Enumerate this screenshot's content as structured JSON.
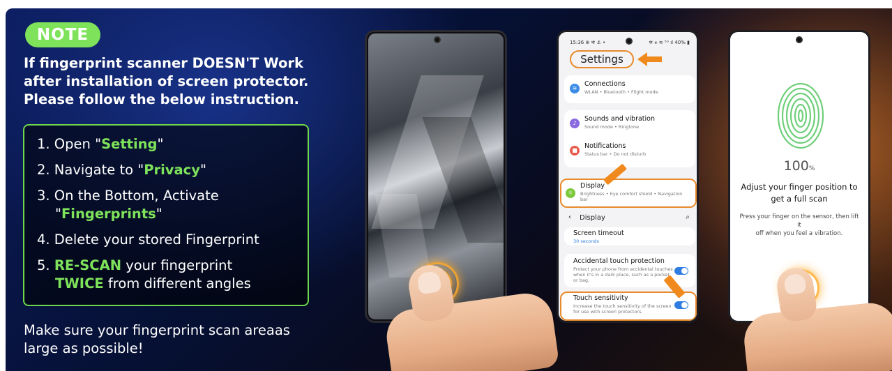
{
  "note_badge": "NOTE",
  "intro": {
    "line1": "If fingerprint scanner DOESN'T Work",
    "line2": "after installation of screen protector.",
    "line3": "Please follow the below instruction."
  },
  "steps": {
    "s1_pre": "1. Open \"",
    "s1_hl": "Setting",
    "s1_post": "\"",
    "s2_pre": "2. Navigate to \"",
    "s2_hl": "Privacy",
    "s2_post": "\"",
    "s3_line1": "3. On the Bottom, Activate",
    "s3_pre": "\"",
    "s3_hl": "Fingerprints",
    "s3_post": "\"",
    "s4": "4. Delete your stored Fingerprint",
    "s5_pre": "5. ",
    "s5_hl1": "RE-SCAN",
    "s5_mid": " your fingerprint",
    "s5_hl2": "TWICE",
    "s5_post": " from different angles"
  },
  "footer": {
    "line1": "Make sure your fingerprint scan areaas",
    "line2": "large as possible!"
  },
  "settings_phone": {
    "status_time": "15:36 ⊕ ✲ ⚓ •",
    "status_right": "✲ ⚹ ≋ ⁵ᴳ ıl 40% ▮",
    "title": "Settings",
    "connections": {
      "title": "Connections",
      "sub": "WLAN • Bluetooth • Flight mode"
    },
    "sounds": {
      "title": "Sounds and vibration",
      "sub": "Sound mode • Ringtone"
    },
    "notifications": {
      "title": "Notifications",
      "sub": "Status bar • Do not disturb"
    },
    "display": {
      "title": "Display",
      "sub1": "Brightness • Eye comfort shield • Navigation",
      "sub2": "bar"
    },
    "display_header": "Display",
    "screen_timeout": {
      "title": "Screen timeout",
      "sub": "30 seconds"
    },
    "accidental": {
      "title": "Accidental touch protection",
      "sub1": "Protect your phone from accidental touches",
      "sub2": "when it's in a dark place, such as a pocket",
      "sub3": "or bag."
    },
    "touch": {
      "title": "Touch sensitivity",
      "sub1": "Increase the touch sensitivity of the screen",
      "sub2": "for use with screen protectors."
    }
  },
  "scan_phone": {
    "percent": "100",
    "percent_unit": "%",
    "adjust_line1": "Adjust your finger position to",
    "adjust_line2": "get a full scan",
    "press_line1": "Press your finger on the sensor, then lift it",
    "press_line2": "off when you feel a vibration."
  },
  "colors": {
    "accent_green": "#7ee35a",
    "arrow_orange": "#f08a1e",
    "toggle_blue": "#2f7de1"
  }
}
